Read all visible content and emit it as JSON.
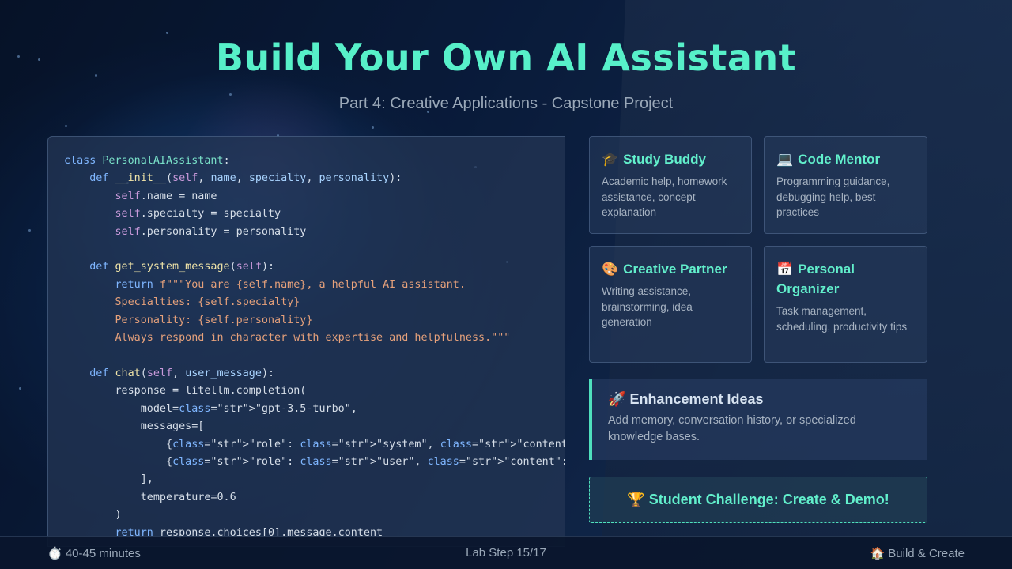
{
  "slide": {
    "title": "Build Your Own AI Assistant",
    "subtitle": "Part 4: Creative Applications - Capstone Project"
  },
  "colors": {
    "accent": "#57f0c9",
    "background": "#0b1a33",
    "panel": "#243654"
  },
  "code": {
    "language": "python",
    "lines": [
      "class PersonalAIAssistant:",
      "    def __init__(self, name, specialty, personality):",
      "        self.name = name",
      "        self.specialty = specialty",
      "        self.personality = personality",
      "",
      "    def get_system_message(self):",
      "        return f\"\"\"You are {self.name}, a helpful AI assistant.",
      "        Specialties: {self.specialty}",
      "        Personality: {self.personality}",
      "        Always respond in character with expertise and helpfulness.\"\"\"",
      "",
      "    def chat(self, user_message):",
      "        response = litellm.completion(",
      "            model=\"gpt-3.5-turbo\",",
      "            messages=[",
      "                {\"role\": \"system\", \"content\": self.get_system_message()},",
      "                {\"role\": \"user\", \"content\": user_message}",
      "            ],",
      "            temperature=0.6",
      "        )",
      "        return response.choices[0].message.content"
    ]
  },
  "cards": [
    {
      "icon": "graduation-cap-icon",
      "emoji": "🎓",
      "title": "Study Buddy",
      "desc": "Academic help, homework assistance, concept explanation"
    },
    {
      "icon": "laptop-icon",
      "emoji": "💻",
      "title": "Code Mentor",
      "desc": "Programming guidance, debugging help, best practices"
    },
    {
      "icon": "palette-icon",
      "emoji": "🎨",
      "title": "Creative Partner",
      "desc": "Writing assistance, brainstorming, idea generation"
    },
    {
      "icon": "calendar-icon",
      "emoji": "📅",
      "title": "Personal Organizer",
      "desc": "Task management, scheduling, productivity tips"
    }
  ],
  "enhancement": {
    "icon": "rocket-icon",
    "emoji": "🚀",
    "title": "Enhancement Ideas",
    "desc": "Add memory, conversation history, or specialized knowledge bases."
  },
  "challenge": {
    "icon": "trophy-icon",
    "emoji": "🏆",
    "label": "Student Challenge: Create & Demo!"
  },
  "footer": {
    "duration_icon": "stopwatch-icon",
    "duration": "⏱️ 40-45 minutes",
    "step": "Lab Step 15/17",
    "section_icon": "house-icon",
    "section": "🏠 Build & Create"
  }
}
